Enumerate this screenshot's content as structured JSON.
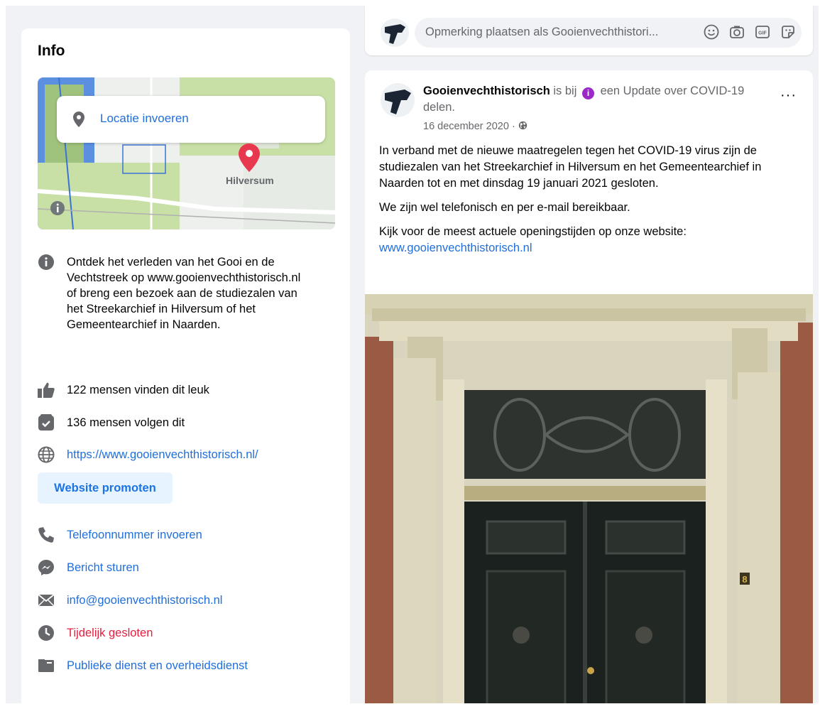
{
  "info": {
    "title": "Info",
    "map": {
      "location_prompt": "Locatie invoeren",
      "city_label": "Hilversum"
    },
    "description": "Ontdek het verleden van het Gooi en de Vechtstreek op www.gooienvechthistorisch.nl of breng een bezoek aan de studiezalen van het Streekarchief in Hilversum of het Gemeentearchief in Naarden.",
    "likes": "122 mensen vinden dit leuk",
    "follows": "136 mensen volgen dit",
    "website": "https://www.gooienvechthistorisch.nl/",
    "promote_button": "Website promoten",
    "phone": "Telefoonnummer invoeren",
    "message": "Bericht sturen",
    "email": "info@gooienvechthistorisch.nl",
    "status": "Tijdelijk gesloten",
    "category": "Publieke dienst en overheidsdienst"
  },
  "comment": {
    "placeholder": "Opmerking plaatsen als Gooienvechthistori...",
    "icons": [
      "emoji-icon",
      "camera-icon",
      "gif-icon",
      "sticker-icon"
    ]
  },
  "post": {
    "author": "Gooienvechthistorisch",
    "action_prefix": " is bij ",
    "action_suffix": " een Update over COVID-19 delen.",
    "date": "16 december 2020 · ",
    "more": "···",
    "paragraphs": [
      "In verband met de nieuwe maatregelen tegen het COVID-19 virus zijn de studiezalen van het Streekarchief in Hilversum en het Gemeentearchief in Naarden tot en met dinsdag 19 januari 2021 gesloten.",
      "We zijn wel telefonisch en per e-mail bereikbaar.",
      "Kijk voor de meest actuele openingstijden op onze website:"
    ],
    "link": "www.gooienvechthistorisch.nl",
    "door_number": "8"
  },
  "colors": {
    "link": "#216fdb",
    "closed": "#e41e3f",
    "badge": "#9b28c7",
    "background": "#f0f2f5"
  }
}
